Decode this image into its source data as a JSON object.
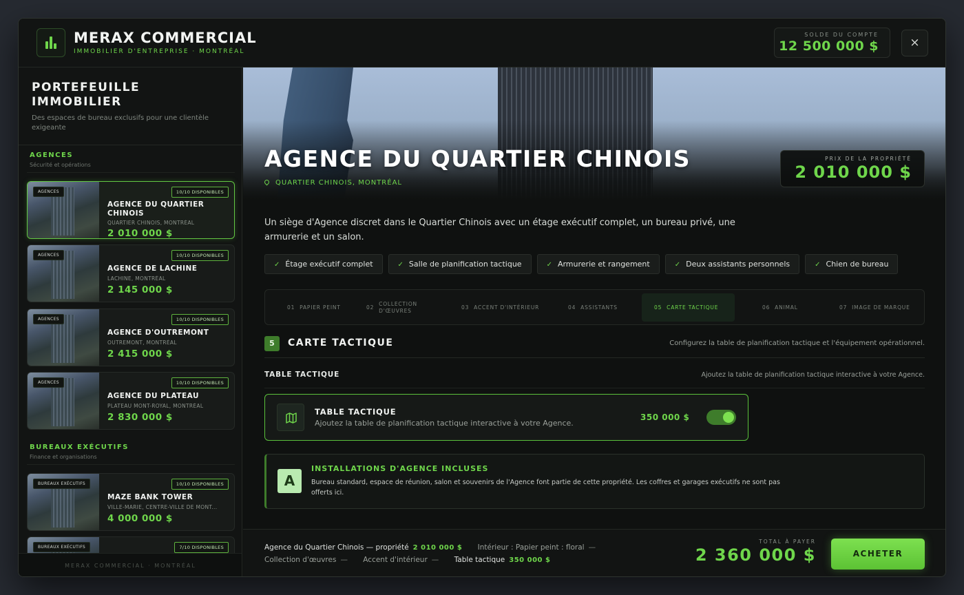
{
  "header": {
    "brand_title": "MERAX COMMERCIAL",
    "brand_subtitle": "IMMOBILIER D'ENTREPRISE · MONTRÉAL",
    "balance_label": "SOLDE DU COMPTE",
    "balance_value": "12 500 000 $",
    "close_icon": "×"
  },
  "sidebar": {
    "title": "PORTEFEUILLE IMMOBILIER",
    "description": "Des espaces de bureau exclusifs pour une clientèle exigeante",
    "sections": [
      {
        "label": "AGENCES",
        "sub": "Sécurité et opérations"
      },
      {
        "label": "BUREAUX EXÉCUTIFS",
        "sub": "Finance et organisations"
      }
    ],
    "cards": [
      {
        "category": "AGENCES",
        "availability": "10/10 DISPONIBLES",
        "name": "AGENCE DU QUARTIER CHINOIS",
        "location": "QUARTIER CHINOIS, MONTRÉAL",
        "price": "2 010 000 $"
      },
      {
        "category": "AGENCES",
        "availability": "10/10 DISPONIBLES",
        "name": "AGENCE DE LACHINE",
        "location": "LACHINE, MONTRÉAL",
        "price": "2 145 000 $"
      },
      {
        "category": "AGENCES",
        "availability": "10/10 DISPONIBLES",
        "name": "AGENCE D'OUTREMONT",
        "location": "OUTREMONT, MONTRÉAL",
        "price": "2 415 000 $"
      },
      {
        "category": "AGENCES",
        "availability": "10/10 DISPONIBLES",
        "name": "AGENCE DU PLATEAU",
        "location": "PLATEAU MONT-ROYAL, MONTRÉAL",
        "price": "2 830 000 $"
      },
      {
        "category": "BUREAUX EXÉCUTIFS",
        "availability": "10/10 DISPONIBLES",
        "name": "MAZE BANK TOWER",
        "location": "VILLE-MARIE, CENTRE-VILLE DE MONT...",
        "price": "4 000 000 $"
      },
      {
        "category": "BUREAUX EXÉCUTIFS",
        "availability": "7/10 DISPONIBLES"
      }
    ],
    "footer": "MERAX COMMERCIAL · MONTRÉAL"
  },
  "property": {
    "title": "AGENCE DU QUARTIER CHINOIS",
    "location": "QUARTIER CHINOIS, MONTRÉAL",
    "price_label": "PRIX DE LA PROPRIÉTÉ",
    "price": "2 010 000 $",
    "description": "Un siège d'Agence discret dans le Quartier Chinois avec un étage exécutif complet, un bureau privé, une armurerie et un salon.",
    "features": [
      "Étage exécutif complet",
      "Salle de planification tactique",
      "Armurerie et rangement",
      "Deux assistants personnels",
      "Chien de bureau"
    ]
  },
  "steps": [
    {
      "num": "01",
      "label": "PAPIER PEINT"
    },
    {
      "num": "02",
      "label": "COLLECTION D'ŒUVRES"
    },
    {
      "num": "03",
      "label": "ACCENT D'INTÉRIEUR"
    },
    {
      "num": "04",
      "label": "ASSISTANTS"
    },
    {
      "num": "05",
      "label": "CARTE TACTIQUE",
      "active": true
    },
    {
      "num": "06",
      "label": "ANIMAL"
    },
    {
      "num": "07",
      "label": "IMAGE DE MARQUE"
    }
  ],
  "section": {
    "number": "5",
    "title": "CARTE TACTIQUE",
    "description": "Configurez la table de planification tactique et l'équipement opérationnel."
  },
  "subsection": {
    "title": "TABLE TACTIQUE",
    "description": "Ajoutez la table de planification tactique interactive à votre Agence."
  },
  "option": {
    "icon": "map-icon",
    "title": "TABLE TACTIQUE",
    "description": "Ajoutez la table de planification tactique interactive à votre Agence.",
    "price": "350 000 $",
    "enabled": true
  },
  "included": {
    "badge": "A",
    "title": "INSTALLATIONS D'AGENCE INCLUSES",
    "description": "Bureau standard, espace de réunion, salon et souvenirs de l'Agence font partie de cette propriété. Les coffres et garages exécutifs ne sont pas offerts ici."
  },
  "summary": {
    "property_label": "Agence du Quartier Chinois — propriété",
    "property_price": "2 010 000 $",
    "interior_label": "Intérieur : Papier peint : floral",
    "dash": "—",
    "art_label": "Collection d'œuvres",
    "accent_label": "Accent d'intérieur",
    "table_label": "Table tactique",
    "table_price": "350 000 $",
    "total_label": "TOTAL À PAYER",
    "total_value": "2 360 000 $",
    "buy_label": "ACHETER"
  },
  "colors": {
    "accent": "#6fd64b",
    "background": "#0f1110"
  }
}
